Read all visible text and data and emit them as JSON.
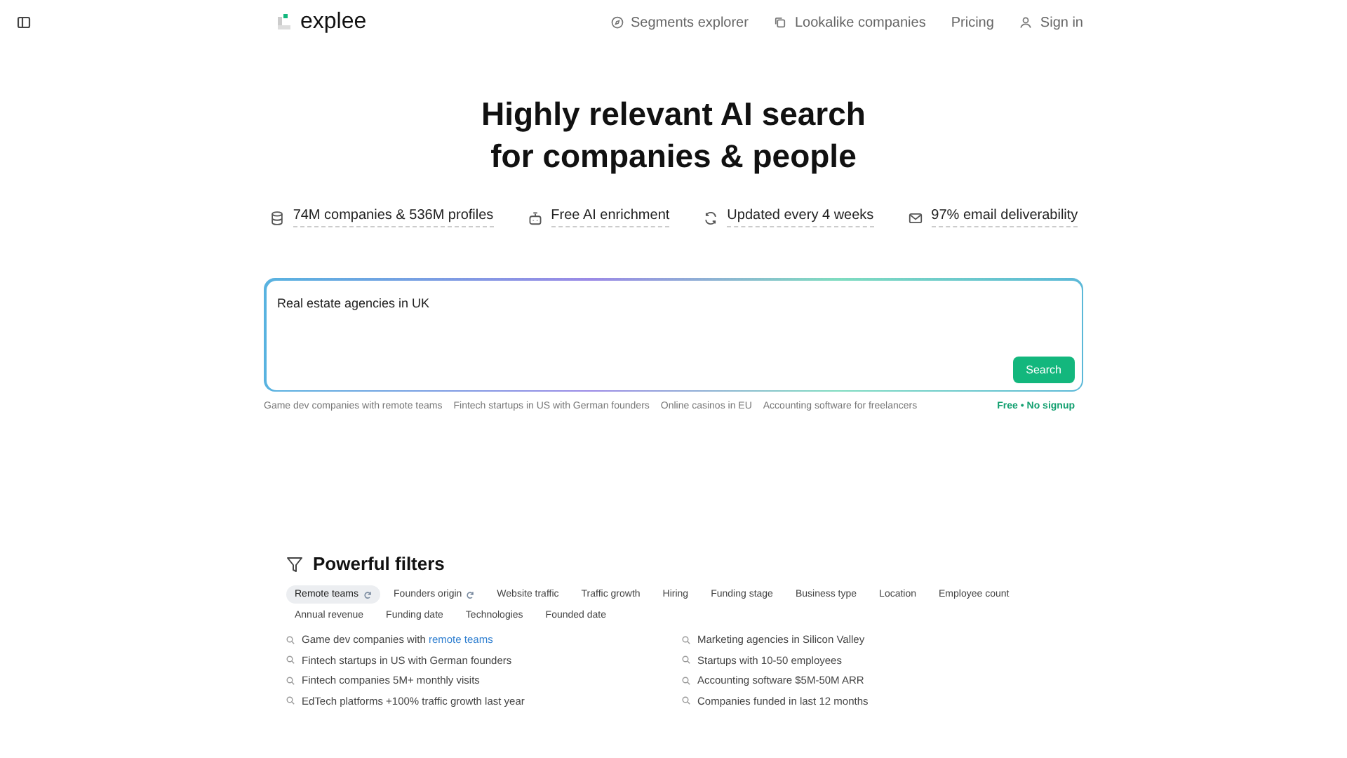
{
  "header": {
    "logo": "explee",
    "nav": [
      {
        "kind": "segments",
        "label": "Segments explorer"
      },
      {
        "kind": "lookalike",
        "label": "Lookalike companies"
      },
      {
        "kind": "plain",
        "label": "Pricing"
      },
      {
        "kind": "user",
        "label": "Sign in"
      }
    ]
  },
  "hero": {
    "title_lines": [
      "Highly relevant AI search",
      "for companies & people"
    ]
  },
  "features": [
    {
      "kind": "database",
      "label": "74M companies & 536M profiles"
    },
    {
      "kind": "robot",
      "label": "Free AI enrichment"
    },
    {
      "kind": "refresh",
      "label": "Updated every 4 weeks"
    },
    {
      "kind": "mail",
      "label": "97% email deliverability"
    }
  ],
  "search": {
    "value": "Real estate agencies in UK",
    "button": "Search"
  },
  "suggestions": [
    "Game dev companies with remote teams",
    "Fintech startups in US with German founders",
    "Online casinos in EU",
    "Accounting software for freelancers"
  ],
  "free_note": "Free • No signup",
  "filters": {
    "title": "Powerful filters",
    "chips": [
      {
        "label": "Remote teams",
        "selected": true,
        "new": true
      },
      {
        "label": "Founders origin",
        "selected": false,
        "new": true
      },
      {
        "label": "Website traffic",
        "selected": false,
        "new": false
      },
      {
        "label": "Traffic growth",
        "selected": false,
        "new": false
      },
      {
        "label": "Hiring",
        "selected": false,
        "new": false
      },
      {
        "label": "Funding stage",
        "selected": false,
        "new": false
      },
      {
        "label": "Business type",
        "selected": false,
        "new": false
      },
      {
        "label": "Location",
        "selected": false,
        "new": false
      },
      {
        "label": "Employee count",
        "selected": false,
        "new": false
      },
      {
        "label": "Annual revenue",
        "selected": false,
        "new": false
      },
      {
        "label": "Funding date",
        "selected": false,
        "new": false
      },
      {
        "label": "Technologies",
        "selected": false,
        "new": false
      },
      {
        "label": "Founded date",
        "selected": false,
        "new": false
      }
    ],
    "examples": [
      "Game dev companies with **remote teams**",
      "Marketing agencies in Silicon Valley",
      "Fintech startups in US with German founders",
      "Startups with 10-50 employees",
      "Fintech companies 5M+ monthly visits",
      "Accounting software $5M-50M ARR",
      "EdTech platforms +100% traffic growth last year",
      "Companies funded in last 12 months"
    ]
  }
}
